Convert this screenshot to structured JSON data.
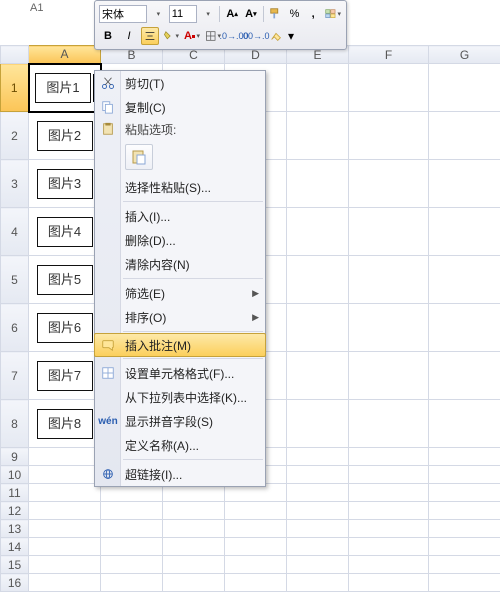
{
  "cell_ref": "A1",
  "toolbar": {
    "font_name": "宋体",
    "font_size": "11",
    "bold": "B",
    "italic": "I",
    "percent": "%",
    "comma": ","
  },
  "columns": [
    "A",
    "B",
    "C",
    "D",
    "E",
    "F",
    "G"
  ],
  "tall_rows": [
    "1",
    "2",
    "3",
    "4",
    "5",
    "6",
    "7",
    "8"
  ],
  "short_rows": [
    "9",
    "10",
    "11",
    "12",
    "13",
    "14",
    "15",
    "16"
  ],
  "cellsA": [
    "图片1",
    "图片2",
    "图片3",
    "图片4",
    "图片5",
    "图片6",
    "图片7",
    "图片8"
  ],
  "ctx": {
    "cut": "剪切(T)",
    "copy": "复制(C)",
    "paste_options": "粘贴选项:",
    "paste_special": "选择性粘贴(S)...",
    "insert": "插入(I)...",
    "delete": "删除(D)...",
    "clear": "清除内容(N)",
    "filter": "筛选(E)",
    "sort": "排序(O)",
    "insert_comment": "插入批注(M)",
    "format_cells": "设置单元格格式(F)...",
    "pick_list": "从下拉列表中选择(K)...",
    "phonetic": "显示拼音字段(S)",
    "define_name": "定义名称(A)...",
    "hyperlink": "超链接(I)..."
  }
}
